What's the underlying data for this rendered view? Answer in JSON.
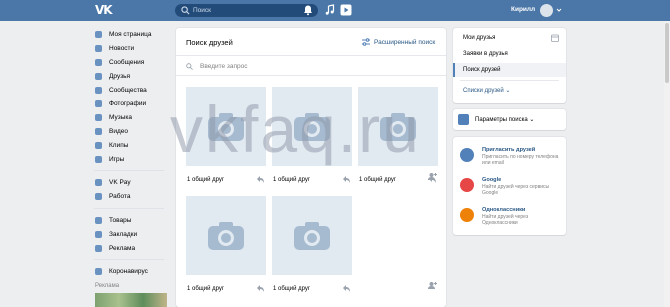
{
  "topbar": {
    "logo": "VK",
    "search_placeholder": "Поиск",
    "user_name": "Кирилл"
  },
  "sidebar": {
    "items": [
      {
        "label": "Моя страница",
        "icon": "home-icon"
      },
      {
        "label": "Новости",
        "icon": "news-icon"
      },
      {
        "label": "Сообщения",
        "icon": "messages-icon"
      },
      {
        "label": "Друзья",
        "icon": "friends-icon"
      },
      {
        "label": "Сообщества",
        "icon": "communities-icon"
      },
      {
        "label": "Фотографии",
        "icon": "photos-icon"
      },
      {
        "label": "Музыка",
        "icon": "music-icon"
      },
      {
        "label": "Видео",
        "icon": "video-icon"
      },
      {
        "label": "Клипы",
        "icon": "clips-icon"
      },
      {
        "label": "Игры",
        "icon": "games-icon"
      }
    ],
    "items2": [
      {
        "label": "VK Pay",
        "icon": "vkpay-icon"
      },
      {
        "label": "Работа",
        "icon": "work-icon"
      }
    ],
    "items3": [
      {
        "label": "Товары",
        "icon": "goods-icon"
      },
      {
        "label": "Закладки",
        "icon": "bookmarks-icon"
      },
      {
        "label": "Реклама",
        "icon": "ads-icon"
      }
    ],
    "items4": [
      {
        "label": "Коронавирус",
        "icon": "coronavirus-icon"
      }
    ],
    "ads_label": "Реклама"
  },
  "main": {
    "title": "Поиск друзей",
    "advanced_search": "Расширенный поиск",
    "search_placeholder": "Введите запрос",
    "cards": [
      {
        "caption": "1 общий друг"
      },
      {
        "caption": "1 общий друг"
      },
      {
        "caption": "1 общий друг"
      },
      {
        "caption": "1 общий друг"
      },
      {
        "caption": "1 общий друг"
      }
    ]
  },
  "right_menu": {
    "items": [
      "Мои друзья",
      "Заявки в друзья",
      "Поиск друзей"
    ],
    "lists": "Списки друзей",
    "active": "Поиск друзей"
  },
  "params": {
    "label": "Параметры поиска"
  },
  "invite": [
    {
      "title": "Пригласить друзей",
      "desc": "Пригласить по номеру телефона или email",
      "color": "#5181b8"
    },
    {
      "title": "Google",
      "desc": "Найти друзей через сервисы Google",
      "color": "#e64646"
    },
    {
      "title": "Одноклассники",
      "desc": "Найти друзей через Одноклассники",
      "color": "#ee8208"
    }
  ],
  "watermark": "vkfaq.ru"
}
